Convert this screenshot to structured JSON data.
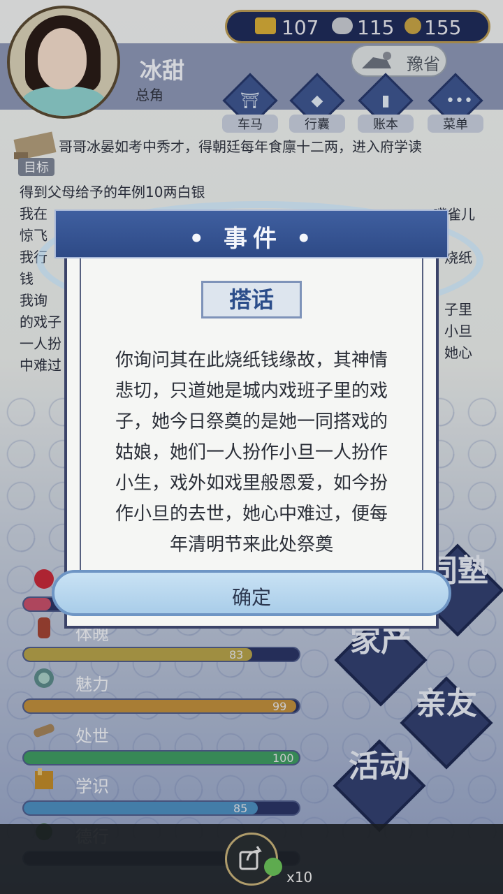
{
  "player": {
    "name": "冰甜",
    "role": "总角"
  },
  "currency": {
    "gold": "107",
    "silver": "115",
    "coin": "155"
  },
  "province": {
    "label": "豫省"
  },
  "menu": [
    {
      "label": "车马",
      "icon": "carriage-icon"
    },
    {
      "label": "行囊",
      "icon": "bag-icon"
    },
    {
      "label": "账本",
      "icon": "ledger-icon"
    },
    {
      "label": "菜单",
      "icon": "more-icon"
    }
  ],
  "goal": {
    "label": "目标",
    "text": "哥哥冰晏如考中秀才，得朝廷每年食廪十二两，进入府学读"
  },
  "log": [
    "得到父母给予的年例10两白银",
    "我在",
    "惊飞",
    "我行",
    "钱",
    "我询",
    "的戏子",
    "一人扮",
    "中难过"
  ],
  "log_right": [
    "嘴雀儿",
    "烧纸",
    "子里",
    "小旦",
    "她心"
  ],
  "stats": [
    {
      "label": "",
      "value": 0,
      "fraction": 0.1,
      "color": "#c6506a"
    },
    {
      "label": "体魄",
      "value": 83,
      "fraction": 0.83,
      "color": "#b5a24a"
    },
    {
      "label": "魅力",
      "value": 99,
      "fraction": 0.99,
      "color": "#c08f3d"
    },
    {
      "label": "处世",
      "value": 100,
      "fraction": 1.0,
      "color": "#3f9b62"
    },
    {
      "label": "学识",
      "value": 85,
      "fraction": 0.85,
      "color": "#4d8fc0"
    },
    {
      "label": "德行",
      "value": 0,
      "fraction": 0.0,
      "color": "#b04a7a"
    }
  ],
  "side_actions": [
    {
      "label": "同塾"
    },
    {
      "label": "家产"
    },
    {
      "label": "亲友"
    },
    {
      "label": "活动"
    }
  ],
  "share": {
    "count": "x10"
  },
  "dialog": {
    "title": "• 事件 •",
    "subtitle": "搭话",
    "body_lines": [
      "你询问其在此烧纸钱缘故，其神情",
      "悲切，只道她是城内戏班子里的戏",
      "子，她今日祭奠的是她一同搭戏的",
      "姑娘，她们一人扮作小旦一人扮作",
      "小生，戏外如戏里般恩爱，如今扮",
      "作小旦的去世，她心中难过，便每",
      "年清明节来此处祭奠"
    ],
    "confirm": "确定"
  },
  "colors": {
    "accent": "#3e5690",
    "gold": "#b99a55",
    "panel": "#f5f6f4"
  }
}
